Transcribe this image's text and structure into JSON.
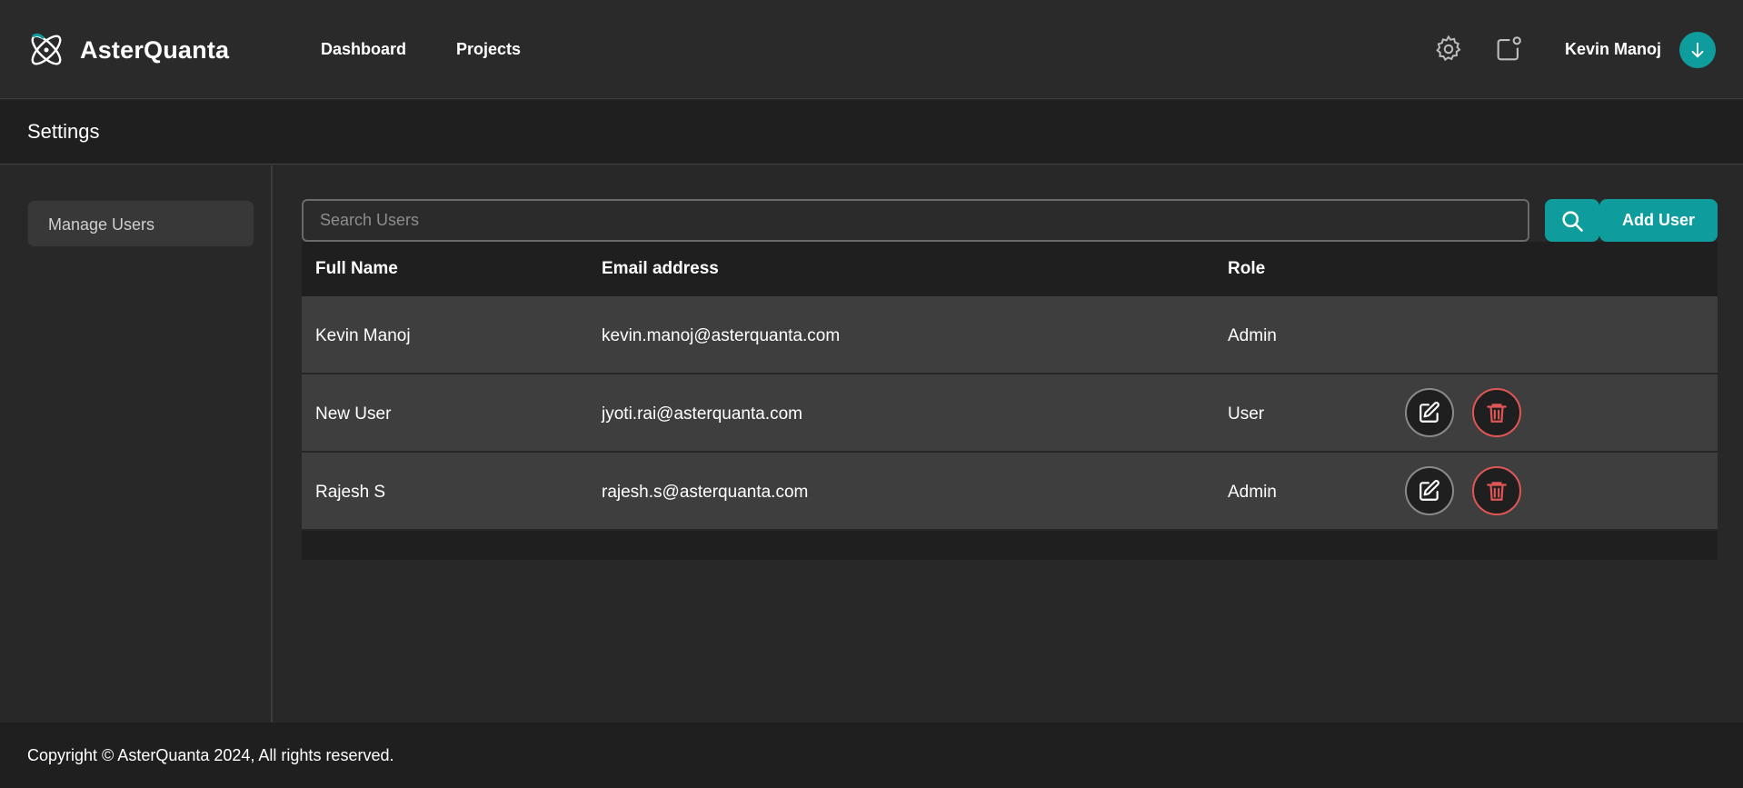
{
  "app": {
    "name": "AsterQuanta"
  },
  "nav": {
    "dashboard": "Dashboard",
    "projects": "Projects"
  },
  "user": {
    "name": "Kevin Manoj"
  },
  "page": {
    "title": "Settings"
  },
  "sidebar": {
    "items": [
      {
        "label": "Manage Users"
      }
    ]
  },
  "search": {
    "placeholder": "Search Users",
    "value": ""
  },
  "toolbar": {
    "add_user_label": "Add User"
  },
  "table": {
    "columns": [
      "Full Name",
      "Email address",
      "Role"
    ],
    "rows": [
      {
        "name": "Kevin Manoj",
        "email": "kevin.manoj@asterquanta.com",
        "role": "Admin",
        "actions": false
      },
      {
        "name": "New User",
        "email": "jyoti.rai@asterquanta.com",
        "role": "User",
        "actions": true
      },
      {
        "name": "Rajesh S",
        "email": "rajesh.s@asterquanta.com",
        "role": "Admin",
        "actions": true
      }
    ]
  },
  "footer": {
    "copyright": "Copyright © AsterQuanta 2024, All rights reserved."
  },
  "colors": {
    "accent": "#0e9c9c",
    "danger": "#e05656",
    "background": "#282828"
  },
  "icons": {
    "logo": "atom-logo-icon",
    "settings": "gear-icon",
    "notifications": "notification-icon",
    "user_menu": "arrow-down-icon",
    "search": "search-icon",
    "edit": "edit-icon",
    "delete": "trash-icon"
  }
}
